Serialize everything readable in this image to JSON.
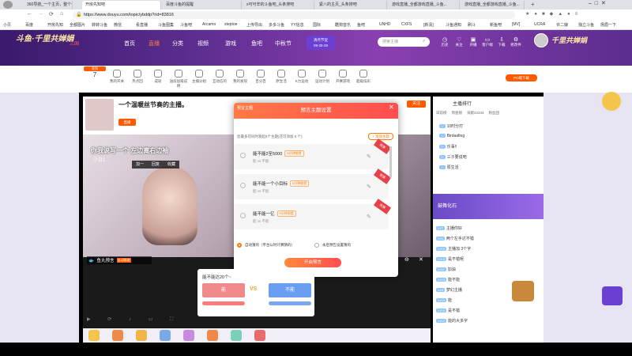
{
  "browser": {
    "tabs": [
      "360导航_一个主页，整个世界",
      "开房先知吧",
      "百度斗鱼的提醒",
      "x可可辛的斗鱼吧_头条搜吧",
      "紧八的主页_头条搜吧",
      "游戏直播_全都游戏直播_斗鱼...",
      "游戏直播_全都游戏直播_斗鱼..."
    ],
    "url": "https://www.douyu.com/topic/ybddp?rid=83816",
    "bookmarks": [
      "小贝",
      "百度",
      "开房先知",
      "全都图片",
      "转转斗鱼",
      "微信",
      "看直播",
      "斗鱼图集",
      "斗鱼吧",
      "Arcamo",
      "steptoe",
      "上传导出",
      "多多斗鱼",
      "YY信息",
      "国际",
      "酷狗音乐",
      "鱼吧",
      "UNHD",
      "CXFS",
      "[新清]",
      "斗鱼通知",
      "刷斗",
      "新鱼吧",
      "[MV]",
      "UCRA",
      "许二娘",
      "独立斗鱼",
      "扬眉一下"
    ]
  },
  "site": {
    "nav": [
      "首页",
      "直播",
      "分类",
      "视频",
      "游戏",
      "鱼吧",
      "中秋节"
    ],
    "promo": "清月节促\n09-25-28",
    "search_placeholder": "搜索主播",
    "header_icons": [
      "历史",
      "关注",
      "开播",
      "客户端",
      "下载",
      "修改件"
    ]
  },
  "categories": [
    "主播日程",
    "我的开关",
    "热点回",
    "成就",
    "送段层级说明",
    "主播分组",
    "互动信的",
    "我的发现",
    "百分百",
    "原生活",
    "K力运动",
    "运动计划",
    "开赛游戏",
    "超级炫彩",
    "PC端下载"
  ],
  "stream": {
    "title": "一个温暖丝节奏的主播。",
    "status": "直播",
    "follow": "关注",
    "overlay_text": "你我说写一个 左边离右边袖",
    "overlay_name": "小日1",
    "overlay_buttons": [
      "加一",
      "回复",
      "收藏"
    ],
    "badge": "鱼丸预言",
    "badge2": "自动收缩"
  },
  "modal": {
    "header": "预言主题设置",
    "tab": "预言主题",
    "note": "您最多可同时发起5个主题(还可添加 0 个)",
    "add": "+ 添加主题",
    "questions": [
      {
        "title": "能不能2至5000",
        "tag": "5分钟前提",
        "sub": "能 vs 不能",
        "ribbon": "竞猜"
      },
      {
        "title": "能不能一个小目标",
        "tag": "5分钟前提",
        "sub": "能 vs 不能",
        "ribbon": "竞猜"
      },
      {
        "title": "能不能一亿",
        "tag": "5分钟前提",
        "sub": "能 vs 不能",
        "ribbon": "竞猜"
      }
    ],
    "radio1": "自动猜的（平台以时计算猜的）",
    "radio2": "永后预告设置猜的",
    "start": "开启预言"
  },
  "vote": {
    "title": "能不能达20个~",
    "left": "能",
    "right": "不能",
    "vs": "VS"
  },
  "chat": {
    "rank_title": "主播排行",
    "tabs": [
      "日前榜",
      "周星榜",
      "贡献22344",
      "粉丝团"
    ],
    "rank": [
      "10时分打",
      "Birdaafing",
      "乐事!!",
      "三子要说吧",
      "原生活"
    ],
    "gift_banner": "鼓舞化石",
    "lines": [
      {
        "lv": "LV7",
        "text": "主播你好"
      },
      {
        "lv": "LV6",
        "text": "两个左手达不错"
      },
      {
        "lv": "LV10",
        "text": "主播加 3个字"
      },
      {
        "lv": "LV13",
        "text": "是不错呢"
      },
      {
        "lv": "LV11",
        "text": "加油"
      },
      {
        "lv": "LV13",
        "text": "能不能"
      },
      {
        "lv": "LV8",
        "text": "梦幻主播"
      },
      {
        "lv": "LV19",
        "text": "能"
      },
      {
        "lv": "LV19",
        "text": "是不错"
      },
      {
        "lv": "LV12",
        "text": "能的大多字"
      }
    ]
  },
  "colors": {
    "accent": "#ff5a00",
    "purple": "#5b2d8e"
  }
}
